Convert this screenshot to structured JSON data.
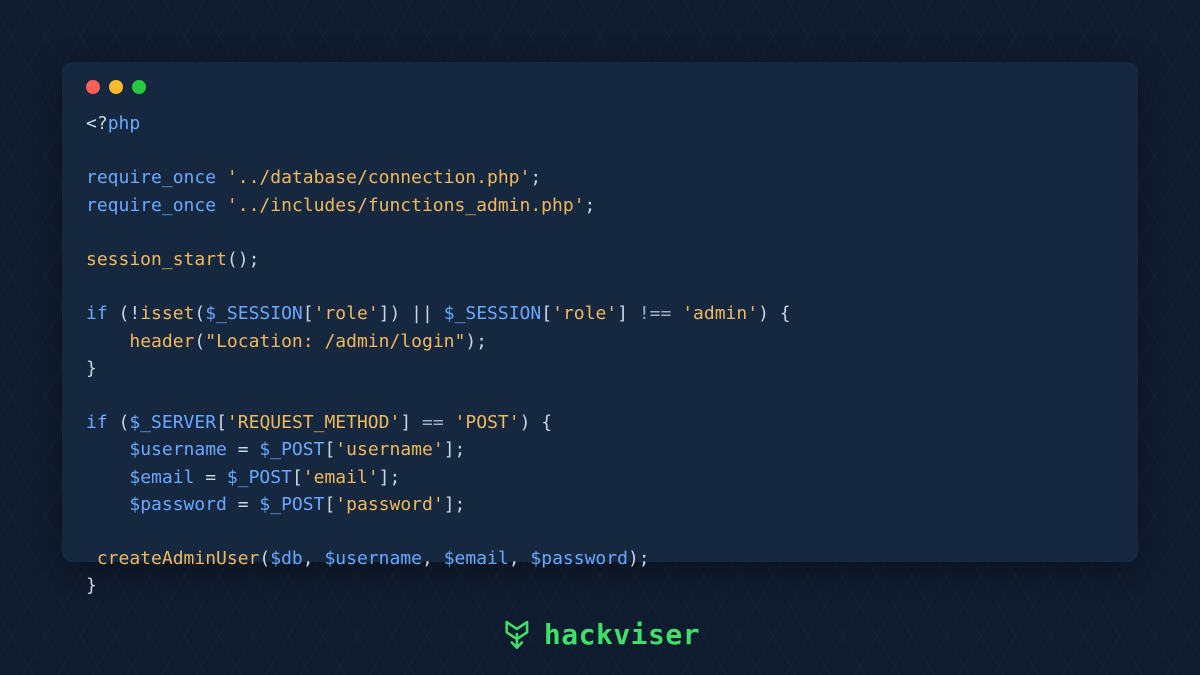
{
  "brand": {
    "name": "hackviser"
  },
  "code": {
    "l1": {
      "open": "<?",
      "php": "php"
    },
    "l3": {
      "req": "require_once",
      "sp": " ",
      "q1": "'",
      "path": "../database/connection.php",
      "q2": "'",
      "semi": ";"
    },
    "l4": {
      "req": "require_once",
      "sp": " ",
      "q1": "'",
      "path": "../includes/functions_admin.php",
      "q2": "'",
      "semi": ";"
    },
    "l6": {
      "fn": "session_start",
      "paren": "();"
    },
    "l8": {
      "if": "if",
      "sp1": " (!",
      "isset": "isset",
      "op1": "(",
      "var1": "$_SESSION",
      "br1": "[",
      "q1": "'",
      "k1": "role",
      "q2": "'",
      "br2": "]) || ",
      "var2": "$_SESSION",
      "br3": "[",
      "q3": "'",
      "k2": "role",
      "q4": "'",
      "br4": "] ",
      "neq": "!==",
      "sp2": " ",
      "q5": "'",
      "val": "admin",
      "q6": "'",
      "end": ") {"
    },
    "l9": {
      "indent": "    ",
      "fn": "header",
      "op1": "(",
      "q1": "\"",
      "str": "Location: /admin/login",
      "q2": "\"",
      "end": ");"
    },
    "l10": {
      "brace": "}"
    },
    "l12": {
      "if": "if",
      "sp1": " (",
      "var1": "$_SERVER",
      "br1": "[",
      "q1": "'",
      "k1": "REQUEST_METHOD",
      "q2": "'",
      "br2": "] ",
      "eq": "==",
      "sp2": " ",
      "q3": "'",
      "val": "POST",
      "q4": "'",
      "end": ") {"
    },
    "l13": {
      "indent": "    ",
      "var1": "$username",
      "sp1": " = ",
      "var2": "$_POST",
      "br1": "[",
      "q1": "'",
      "k1": "username",
      "q2": "'",
      "end": "];"
    },
    "l14": {
      "indent": "    ",
      "var1": "$email",
      "sp1": " = ",
      "var2": "$_POST",
      "br1": "[",
      "q1": "'",
      "k1": "email",
      "q2": "'",
      "end": "];"
    },
    "l15": {
      "indent": "    ",
      "var1": "$password",
      "sp1": " = ",
      "var2": "$_POST",
      "br1": "[",
      "q1": "'",
      "k1": "password",
      "q2": "'",
      "end": "];"
    },
    "l17": {
      "indent": " ",
      "fn": "createAdminUser",
      "op1": "(",
      "v1": "$db",
      "c1": ", ",
      "v2": "$username",
      "c2": ", ",
      "v3": "$email",
      "c3": ", ",
      "v4": "$password",
      "end": ");"
    },
    "l18": {
      "brace": "}"
    }
  }
}
